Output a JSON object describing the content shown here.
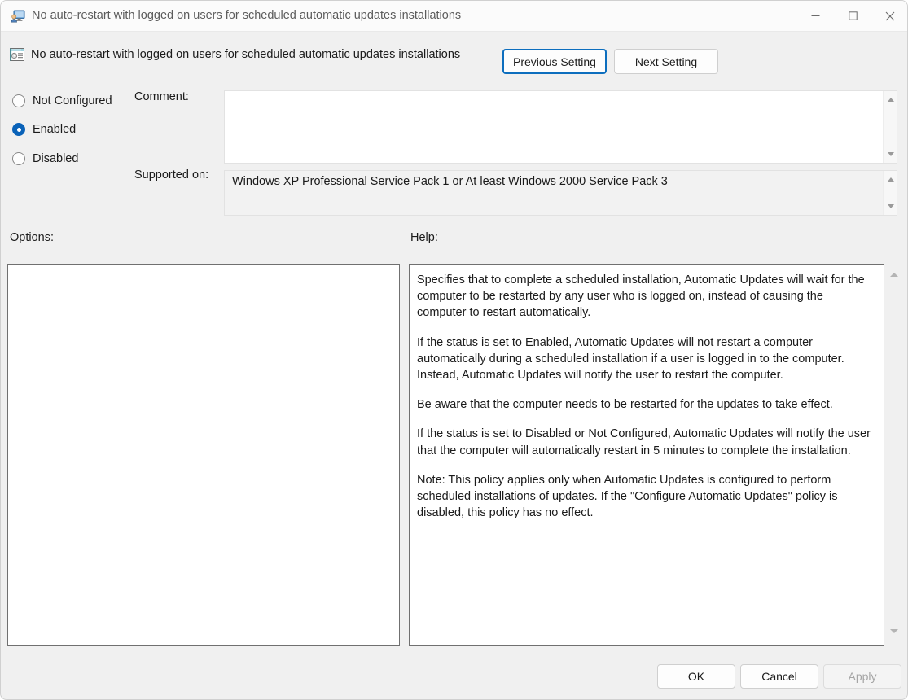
{
  "window": {
    "title": "No auto-restart with logged on users for scheduled automatic updates installations",
    "icons": {
      "title": "policy-computer-user-icon",
      "minimize": "minimize-icon",
      "maximize": "maximize-icon",
      "close": "close-icon"
    }
  },
  "header": {
    "policy_name": "No auto-restart with logged on users for scheduled automatic updates installations",
    "policy_icon": "admin-template-policy-icon",
    "previous_setting_label": "Previous Setting",
    "next_setting_label": "Next Setting"
  },
  "state": {
    "options": [
      {
        "label": "Not Configured",
        "checked": false
      },
      {
        "label": "Enabled",
        "checked": true
      },
      {
        "label": "Disabled",
        "checked": false
      }
    ],
    "selected": "Enabled"
  },
  "fields": {
    "comment_label": "Comment:",
    "comment_value": "",
    "comment_placeholder": "",
    "supported_label": "Supported on:",
    "supported_value": "Windows XP Professional Service Pack 1 or At least Windows 2000 Service Pack 3"
  },
  "panels": {
    "options_label": "Options:",
    "options_content": "",
    "help_label": "Help:",
    "help_paragraphs": [
      "Specifies that to complete a scheduled installation, Automatic Updates will wait for the computer to be restarted by any user who is logged on, instead of causing the computer to restart automatically.",
      "If the status is set to Enabled, Automatic Updates will not restart a computer automatically during a scheduled installation if a user is logged in to the computer. Instead, Automatic Updates will notify the user to restart the computer.",
      "Be aware that the computer needs to be restarted for the updates to take effect.",
      "If the status is set to Disabled or Not Configured, Automatic Updates will notify the user that the computer will automatically restart in 5 minutes to complete the installation.",
      "Note: This policy applies only when Automatic Updates is configured to perform scheduled installations of updates. If the \"Configure Automatic Updates\" policy is disabled, this policy has no effect."
    ]
  },
  "footer": {
    "ok_label": "OK",
    "cancel_label": "Cancel",
    "apply_label": "Apply",
    "apply_disabled": true
  },
  "colors": {
    "accent": "#0a62b8",
    "focus_border": "#0d6ebe",
    "dialog_bg": "#f0f0f0",
    "titlebar_bg": "#fbfbfb",
    "text": "#1b1b1b",
    "title_text": "#5c5c5c",
    "disabled_text": "#a5a5a5",
    "panel_border": "#707070",
    "readonly_bg": "#f2f2f2"
  }
}
